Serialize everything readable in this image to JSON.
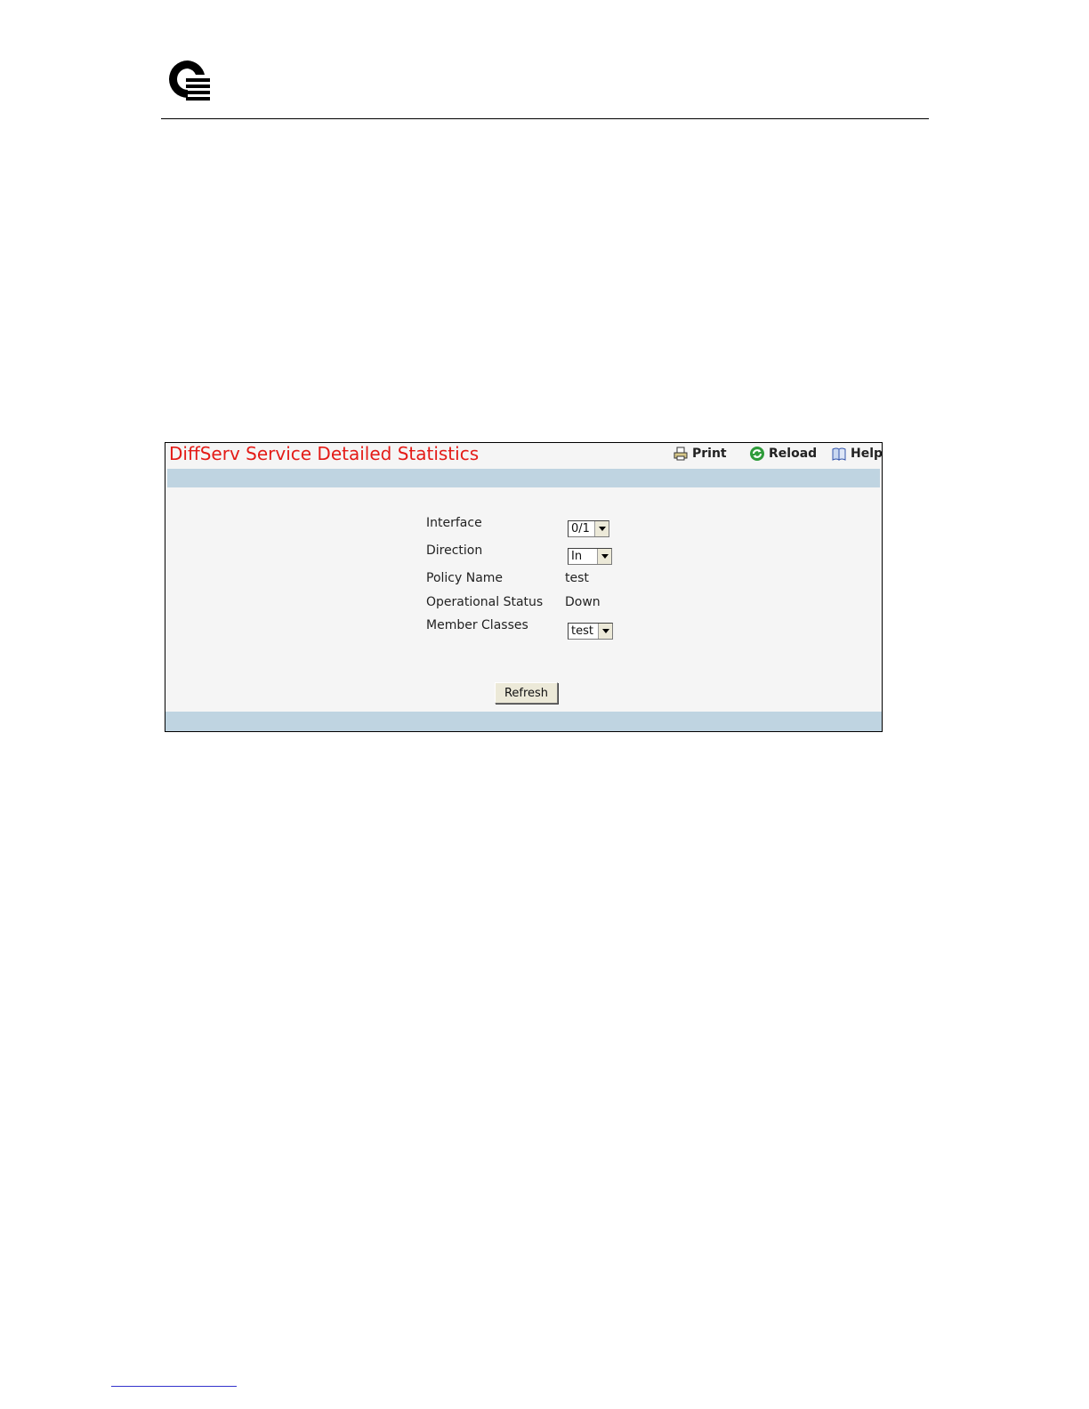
{
  "panel": {
    "title": "DiffServ Service Detailed Statistics",
    "toolbar": {
      "print_label": "Print",
      "reload_label": "Reload",
      "help_label": "Help"
    }
  },
  "form": {
    "interface": {
      "label": "Interface",
      "selected": "0/1"
    },
    "direction": {
      "label": "Direction",
      "selected": "In"
    },
    "policy_name": {
      "label": "Policy Name",
      "value": "test"
    },
    "operational_status": {
      "label": "Operational Status",
      "value": "Down"
    },
    "member_classes": {
      "label": "Member Classes",
      "selected": "test"
    },
    "refresh_label": "Refresh"
  },
  "colors": {
    "title": "#e41b17",
    "band": "#bfd4e1",
    "panel_bg": "#f5f5f5"
  }
}
